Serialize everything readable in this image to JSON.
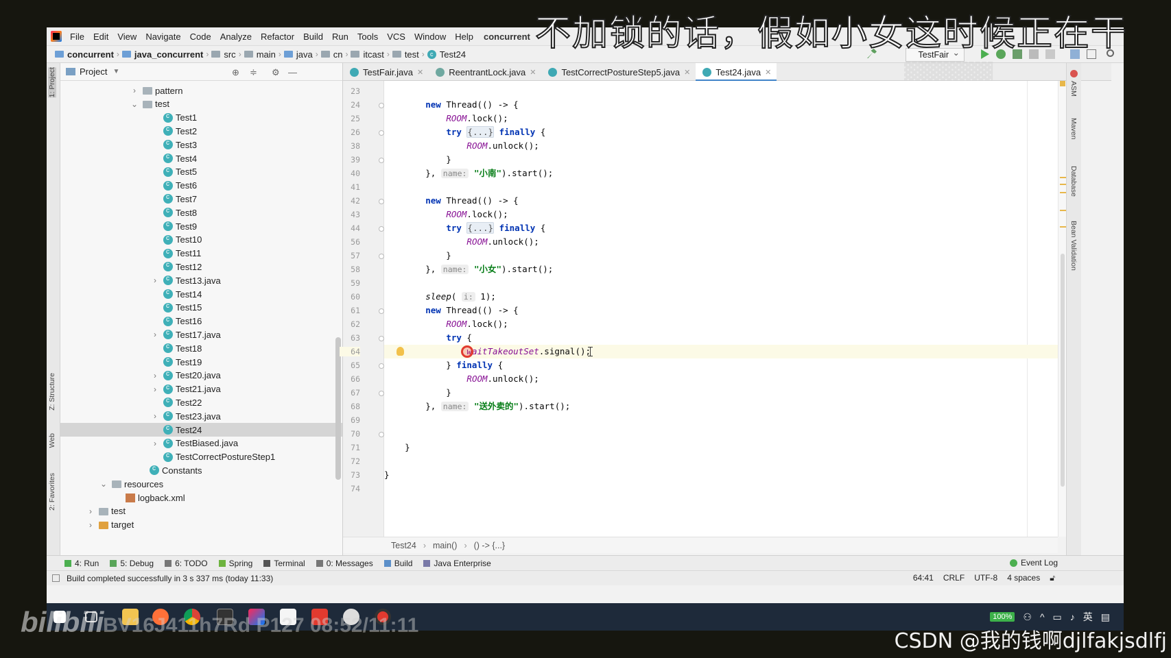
{
  "menu": {
    "items": [
      "File",
      "Edit",
      "View",
      "Navigate",
      "Code",
      "Analyze",
      "Refactor",
      "Build",
      "Run",
      "Tools",
      "VCS",
      "Window",
      "Help"
    ],
    "title": "concurrent"
  },
  "navbar": {
    "crumbs": [
      "concurrent",
      "java_concurrent",
      "src",
      "main",
      "java",
      "cn",
      "itcast",
      "test",
      "Test24"
    ],
    "run_config": "TestFair"
  },
  "left_stripe": {
    "project": "1: Project",
    "structure": "Z: Structure",
    "web": "Web",
    "favorites": "2: Favorites"
  },
  "right_stripe": {
    "ant": "ASM",
    "maven": "Maven",
    "database": "Database",
    "bean": "Bean Validation"
  },
  "project_panel": {
    "title": "Project",
    "tree": [
      {
        "label": "pattern",
        "icon": "folder-icon",
        "arrow": "›"
      },
      {
        "label": "test",
        "icon": "folder-icon",
        "arrow": "⌄"
      },
      {
        "label": "Test1",
        "icon": "class-icon",
        "arrow": ""
      },
      {
        "label": "Test2",
        "icon": "class-icon",
        "arrow": ""
      },
      {
        "label": "Test3",
        "icon": "class-icon",
        "arrow": ""
      },
      {
        "label": "Test4",
        "icon": "class-icon",
        "arrow": ""
      },
      {
        "label": "Test5",
        "icon": "class-icon",
        "arrow": ""
      },
      {
        "label": "Test6",
        "icon": "class-icon",
        "arrow": ""
      },
      {
        "label": "Test7",
        "icon": "class-icon",
        "arrow": ""
      },
      {
        "label": "Test8",
        "icon": "class-icon",
        "arrow": ""
      },
      {
        "label": "Test9",
        "icon": "class-icon",
        "arrow": ""
      },
      {
        "label": "Test10",
        "icon": "class-icon",
        "arrow": ""
      },
      {
        "label": "Test11",
        "icon": "class-icon",
        "arrow": ""
      },
      {
        "label": "Test12",
        "icon": "class-icon",
        "arrow": ""
      },
      {
        "label": "Test13.java",
        "icon": "class-icon",
        "arrow": "›"
      },
      {
        "label": "Test14",
        "icon": "class-icon",
        "arrow": ""
      },
      {
        "label": "Test15",
        "icon": "class-icon",
        "arrow": ""
      },
      {
        "label": "Test16",
        "icon": "class-icon",
        "arrow": ""
      },
      {
        "label": "Test17.java",
        "icon": "class-icon",
        "arrow": "›"
      },
      {
        "label": "Test18",
        "icon": "class-icon",
        "arrow": ""
      },
      {
        "label": "Test19",
        "icon": "class-icon",
        "arrow": ""
      },
      {
        "label": "Test20.java",
        "icon": "class-icon",
        "arrow": "›"
      },
      {
        "label": "Test21.java",
        "icon": "class-icon",
        "arrow": "›"
      },
      {
        "label": "Test22",
        "icon": "class-icon",
        "arrow": ""
      },
      {
        "label": "Test23.java",
        "icon": "class-icon",
        "arrow": "›"
      },
      {
        "label": "Test24",
        "icon": "class-icon",
        "arrow": "",
        "selected": true
      },
      {
        "label": "TestBiased.java",
        "icon": "class-icon",
        "arrow": "›"
      },
      {
        "label": "TestCorrectPostureStep1",
        "icon": "class-icon",
        "arrow": ""
      },
      {
        "label": "Constants",
        "icon": "class-icon",
        "arrow": ""
      },
      {
        "label": "resources",
        "icon": "folder-icon",
        "arrow": "⌄"
      },
      {
        "label": "logback.xml",
        "icon": "xml-icon",
        "arrow": ""
      },
      {
        "label": "test",
        "icon": "folder-icon",
        "arrow": "›"
      },
      {
        "label": "target",
        "icon": "folder-orange-icon",
        "arrow": "›"
      }
    ]
  },
  "tabs": [
    {
      "label": "TestFair.java",
      "active": false
    },
    {
      "label": "ReentrantLock.java",
      "active": false
    },
    {
      "label": "TestCorrectPostureStep5.java",
      "active": false
    },
    {
      "label": "Test24.java",
      "active": true
    }
  ],
  "editor": {
    "line_numbers": [
      "23",
      "24",
      "25",
      "26",
      "38",
      "39",
      "40",
      "41",
      "42",
      "43",
      "44",
      "56",
      "57",
      "58",
      "59",
      "60",
      "61",
      "62",
      "63",
      "64",
      "65",
      "66",
      "67",
      "68",
      "69",
      "70",
      "71",
      "72",
      "73",
      "74"
    ],
    "current_line_index": 19,
    "breadcrumb": [
      "Test24",
      "main()",
      "() -> {...}"
    ]
  },
  "bottom_tools": [
    {
      "label": "4: Run",
      "icon": "run-icon"
    },
    {
      "label": "5: Debug",
      "icon": "debug-icon"
    },
    {
      "label": "6: TODO",
      "icon": "todo-icon"
    },
    {
      "label": "Spring",
      "icon": "spring-icon"
    },
    {
      "label": "Terminal",
      "icon": "terminal-icon"
    },
    {
      "label": "0: Messages",
      "icon": "messages-icon"
    },
    {
      "label": "Build",
      "icon": "build-icon"
    },
    {
      "label": "Java Enterprise",
      "icon": "javaee-icon"
    }
  ],
  "event_log": "Event Log",
  "status": {
    "message": "Build completed successfully in 3 s 337 ms (today 11:33)",
    "position": "64:41",
    "line_sep": "CRLF",
    "encoding": "UTF-8",
    "indent": "4 spaces"
  },
  "taskbar": {
    "battery": "100%",
    "ime": "英"
  },
  "overlay": {
    "subtitle": "不加锁的话，假如小女这时候正在干",
    "bili": "bilibili",
    "bvid": "BV16J411h7Rd P127 08:52/11:11",
    "watermark": "CSDN @我的钱啊djlfakjsdlfj"
  },
  "colors": {
    "accent": "#4083c9",
    "keyword": "#0033b3",
    "field": "#871094",
    "string": "#067d17",
    "current_line": "#fcfae6"
  }
}
